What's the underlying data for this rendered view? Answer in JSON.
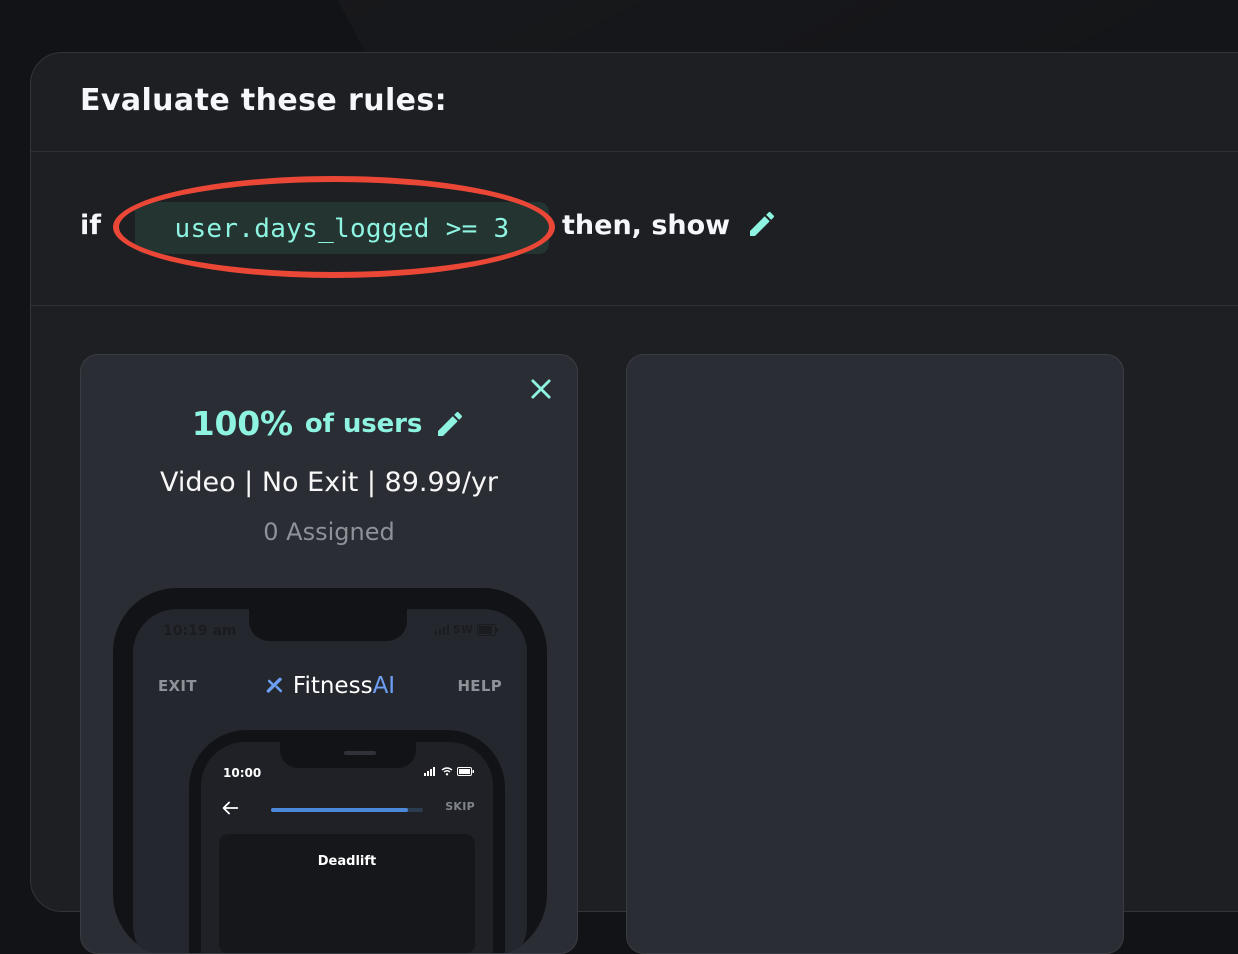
{
  "header": {
    "title": "Evaluate these rules:"
  },
  "rule": {
    "if_label": "if",
    "condition": "user.days_logged >= 3",
    "then_label": "then, show"
  },
  "variant": {
    "percent": "100%",
    "percent_suffix": "of users",
    "description": "Video | No Exit | 89.99/yr",
    "assigned": "0 Assigned"
  },
  "preview": {
    "outer_time": "10:19 am",
    "outer_carrier": "SW",
    "nav_left": "EXIT",
    "nav_right": "HELP",
    "brand_main": "Fitness",
    "brand_accent": "AI",
    "inner_time": "10:00",
    "inner_skip": "SKIP",
    "exercise_name": "Deadlift",
    "progress_fraction": 0.9
  },
  "colors": {
    "accent": "#8ef4e1",
    "highlight": "#eb4737",
    "brand_ai": "#6da0f4"
  },
  "icons": {
    "rule_edit": "pencil-icon",
    "percent_edit": "pencil-icon",
    "close": "close-icon",
    "brand": "fitnessai-logo-icon",
    "back": "arrow-left-icon"
  }
}
